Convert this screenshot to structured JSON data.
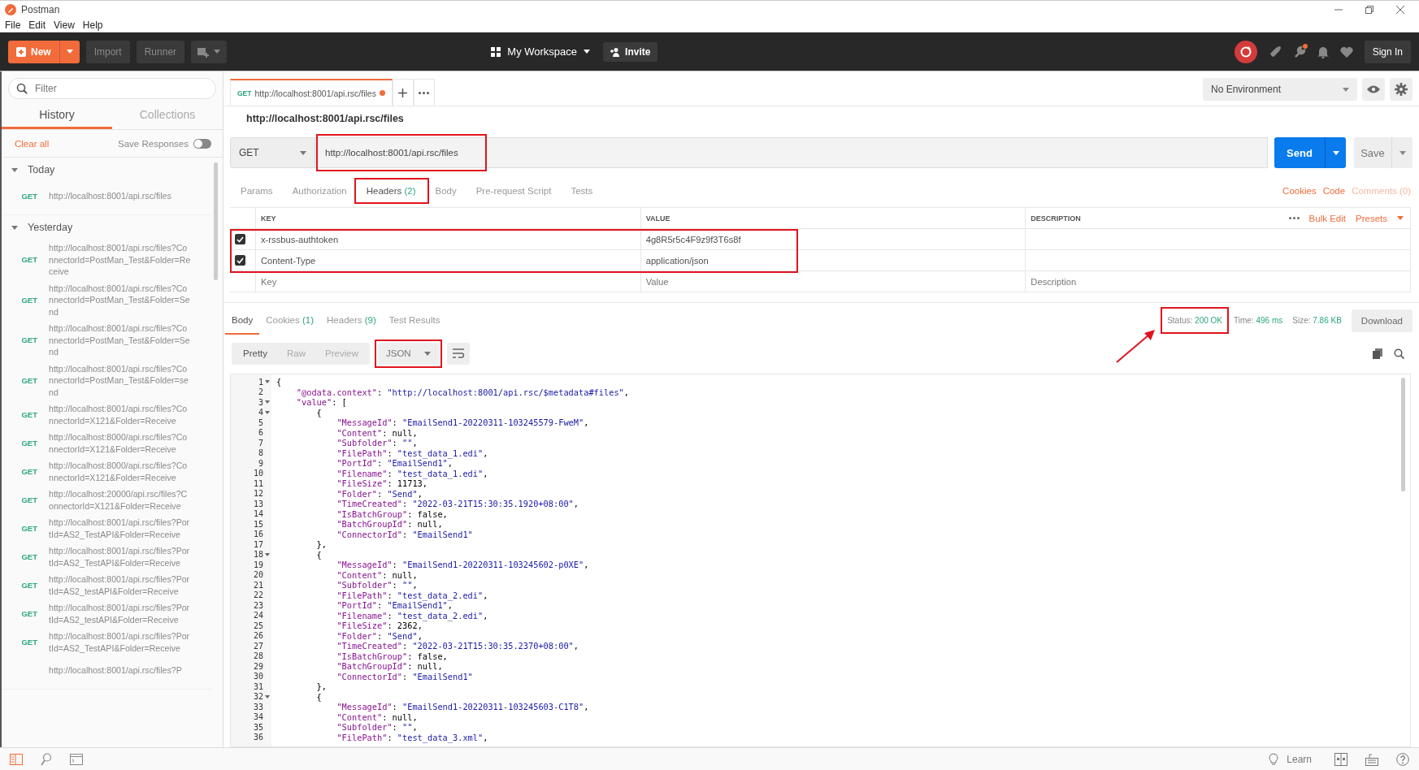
{
  "window": {
    "title": "Postman"
  },
  "menu": [
    "File",
    "Edit",
    "View",
    "Help"
  ],
  "toolbar": {
    "new_label": "New",
    "buttons": [
      "Import",
      "Runner"
    ],
    "workspace": "My Workspace",
    "invite": "Invite",
    "sign_in": "Sign In",
    "notification_dot": true
  },
  "sidebar": {
    "filter_placeholder": "Filter",
    "tabs": [
      {
        "label": "History",
        "selected": true
      },
      {
        "label": "Collections",
        "selected": false
      }
    ],
    "clear_all": "Clear all",
    "save_responses": {
      "label": "Save Responses",
      "on": false
    },
    "groups": [
      {
        "label": "Today",
        "expanded": true,
        "items": [
          {
            "method": "GET",
            "url": "http://localhost:8001/api.rsc/files"
          }
        ]
      },
      {
        "label": "Yesterday",
        "expanded": true,
        "items": [
          {
            "method": "GET",
            "url": "http://localhost:8001/api.rsc/files?ConnectorId=PostMan_Test&Folder=Receive"
          },
          {
            "method": "GET",
            "url": "http://localhost:8001/api.rsc/files?ConnectorId=PostMan_Test&Folder=Send"
          },
          {
            "method": "GET",
            "url": "http://localhost:8001/api.rsc/files?ConnectorId=PostMan_Test&Folder=Send"
          },
          {
            "method": "GET",
            "url": "http://localhost:8001/api.rsc/files?ConnectorId=PostMan_Test&Folder=send"
          },
          {
            "method": "GET",
            "url": "http://localhost:8001/api.rsc/files?ConnectorId=X121&Folder=Receive"
          },
          {
            "method": "GET",
            "url": "http://localhost:8000/api.rsc/files?ConnectorId=X121&Folder=Receive"
          },
          {
            "method": "GET",
            "url": "http://localhost:8000/api.rsc/files?ConnectorId=X121&Folder=Receive"
          },
          {
            "method": "GET",
            "url": "http://localhost:20000/api.rsc/files?ConnectorId=X121&Folder=Receive"
          },
          {
            "method": "GET",
            "url": "http://localhost:8001/api.rsc/files?PortId=AS2_TestAPI&Folder=Receive"
          },
          {
            "method": "GET",
            "url": "http://localhost:8001/api.rsc/files?PortId=AS2_TestAPI&Folder=Receive"
          },
          {
            "method": "GET",
            "url": "http://localhost:8001/api.rsc/files?PortId=AS2_testAPI&Folder=Receive"
          },
          {
            "method": "GET",
            "url": "http://localhost:8001/api.rsc/files?PortId=AS2_testAPI&Folder=Receive"
          },
          {
            "method": "GET",
            "url": "http://localhost:8001/api.rsc/files?PortId=AS2_TestAPI&Folder=Receive"
          },
          {
            "url": "http://localhost:8001/api.rsc/files?P"
          }
        ]
      }
    ]
  },
  "request_tabs": [
    {
      "method": "GET",
      "label": "http://localhost:8001/api.rsc/files",
      "unsaved": true,
      "selected": true
    }
  ],
  "environment": "No Environment",
  "request": {
    "name": "http://localhost:8001/api.rsc/files",
    "method": "GET",
    "url": "http://localhost:8001/api.rsc/files",
    "url_highlighted": true,
    "send": "Send",
    "save": "Save"
  },
  "request_sections": [
    {
      "label": "Params",
      "selected": false,
      "highlighted": false
    },
    {
      "label": "Authorization",
      "selected": false,
      "highlighted": false
    },
    {
      "label": "Headers",
      "count": "(2)",
      "selected": true,
      "highlighted": true
    },
    {
      "label": "Body",
      "selected": false,
      "highlighted": false
    },
    {
      "label": "Pre-request Script",
      "selected": false,
      "highlighted": false
    },
    {
      "label": "Tests",
      "selected": false,
      "highlighted": false
    }
  ],
  "request_links": [
    {
      "label": "Cookies",
      "disabled": false
    },
    {
      "label": "Code",
      "disabled": false
    },
    {
      "label": "Comments (0)",
      "disabled": true
    }
  ],
  "headers": {
    "columns": [
      "KEY",
      "VALUE",
      "DESCRIPTION"
    ],
    "bulk_edit": "Bulk Edit",
    "presets": "Presets",
    "rows_highlighted": true,
    "rows": [
      {
        "checked": true,
        "key": "x-rssbus-authtoken",
        "value": "4g8R5r5c4F9z9f3T6s8f"
      },
      {
        "checked": true,
        "key": "Content-Type",
        "value": "application/json"
      }
    ],
    "new_row": {
      "key": {
        "placeholder": "Key"
      },
      "value": {
        "placeholder": "Value"
      },
      "description": {
        "placeholder": "Description"
      }
    }
  },
  "response_tabs": [
    {
      "label": "Body",
      "selected": true
    },
    {
      "label": "Cookies",
      "count": "(1)",
      "selected": false
    },
    {
      "label": "Headers",
      "count": "(9)",
      "selected": false
    },
    {
      "label": "Test Results",
      "selected": false
    }
  ],
  "response_meta": {
    "status_label": "Status:",
    "status": "200 OK",
    "status_highlighted": true,
    "time_label": "Time:",
    "time": "496 ms",
    "size_label": "Size:",
    "size": "7.86 KB",
    "download": "Download"
  },
  "view_modes": [
    {
      "label": "Pretty",
      "selected": true
    },
    {
      "label": "Raw",
      "selected": false
    },
    {
      "label": "Preview",
      "selected": false
    }
  ],
  "format": {
    "label": "JSON",
    "highlighted": true
  },
  "code": [
    {
      "number": "1",
      "fold": true,
      "text": "{"
    },
    {
      "number": "2",
      "fold": false,
      "text": "    \"@odata.context\": \"http://localhost:8001/api.rsc/$metadata#files\","
    },
    {
      "number": "3",
      "fold": true,
      "text": "    \"value\": ["
    },
    {
      "number": "4",
      "fold": true,
      "text": "        {"
    },
    {
      "number": "5",
      "fold": false,
      "text": "            \"MessageId\": \"EmailSend1-20220311-103245579-FweM\","
    },
    {
      "number": "6",
      "fold": false,
      "text": "            \"Content\": null,"
    },
    {
      "number": "7",
      "fold": false,
      "text": "            \"Subfolder\": \"\","
    },
    {
      "number": "8",
      "fold": false,
      "text": "            \"FilePath\": \"test_data_1.edi\","
    },
    {
      "number": "9",
      "fold": false,
      "text": "            \"PortId\": \"EmailSend1\","
    },
    {
      "number": "10",
      "fold": false,
      "text": "            \"Filename\": \"test_data_1.edi\","
    },
    {
      "number": "11",
      "fold": false,
      "text": "            \"FileSize\": 11713,"
    },
    {
      "number": "12",
      "fold": false,
      "text": "            \"Folder\": \"Send\","
    },
    {
      "number": "13",
      "fold": false,
      "text": "            \"TimeCreated\": \"2022-03-21T15:30:35.1920+08:00\","
    },
    {
      "number": "14",
      "fold": false,
      "text": "            \"IsBatchGroup\": false,"
    },
    {
      "number": "15",
      "fold": false,
      "text": "            \"BatchGroupId\": null,"
    },
    {
      "number": "16",
      "fold": false,
      "text": "            \"ConnectorId\": \"EmailSend1\""
    },
    {
      "number": "17",
      "fold": false,
      "text": "        },"
    },
    {
      "number": "18",
      "fold": true,
      "text": "        {"
    },
    {
      "number": "19",
      "fold": false,
      "text": "            \"MessageId\": \"EmailSend1-20220311-103245602-p0XE\","
    },
    {
      "number": "20",
      "fold": false,
      "text": "            \"Content\": null,"
    },
    {
      "number": "21",
      "fold": false,
      "text": "            \"Subfolder\": \"\","
    },
    {
      "number": "22",
      "fold": false,
      "text": "            \"FilePath\": \"test_data_2.edi\","
    },
    {
      "number": "23",
      "fold": false,
      "text": "            \"PortId\": \"EmailSend1\","
    },
    {
      "number": "24",
      "fold": false,
      "text": "            \"Filename\": \"test_data_2.edi\","
    },
    {
      "number": "25",
      "fold": false,
      "text": "            \"FileSize\": 2362,"
    },
    {
      "number": "26",
      "fold": false,
      "text": "            \"Folder\": \"Send\","
    },
    {
      "number": "27",
      "fold": false,
      "text": "            \"TimeCreated\": \"2022-03-21T15:30:35.2370+08:00\","
    },
    {
      "number": "28",
      "fold": false,
      "text": "            \"IsBatchGroup\": false,"
    },
    {
      "number": "29",
      "fold": false,
      "text": "            \"BatchGroupId\": null,"
    },
    {
      "number": "30",
      "fold": false,
      "text": "            \"ConnectorId\": \"EmailSend1\""
    },
    {
      "number": "31",
      "fold": false,
      "text": "        },"
    },
    {
      "number": "32",
      "fold": true,
      "text": "        {"
    },
    {
      "number": "33",
      "fold": false,
      "text": "            \"MessageId\": \"EmailSend1-20220311-103245603-C1T8\","
    },
    {
      "number": "34",
      "fold": false,
      "text": "            \"Content\": null,"
    },
    {
      "number": "35",
      "fold": false,
      "text": "            \"Subfolder\": \"\","
    },
    {
      "number": "36",
      "fold": false,
      "text": "            \"FilePath\": \"test_data_3.xml\","
    }
  ],
  "status_bar": {
    "learn": "Learn"
  }
}
